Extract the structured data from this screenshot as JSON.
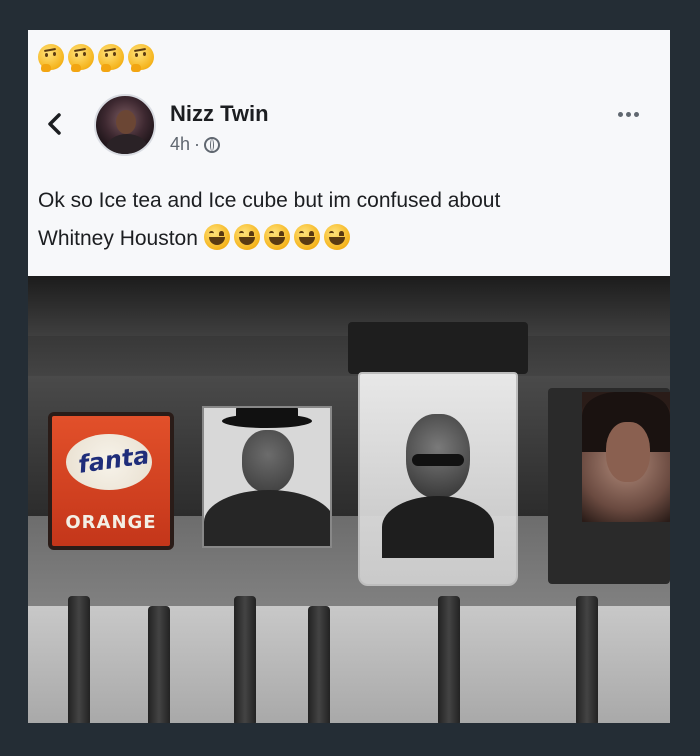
{
  "header": {
    "top_emoji_icon": "thinking-face-icon",
    "top_emoji_count": 4
  },
  "post": {
    "author_name": "Nizz Twin",
    "time": "4h",
    "meta_separator": "·",
    "audience_icon": "globe-icon",
    "text_line1": "Ok so Ice tea and Ice cube but im confused about",
    "text_line2": "Whitney Houston",
    "trailing_emoji_icon": "tears-of-joy-icon",
    "trailing_emoji_count": 5,
    "more_icon": "more-options-icon",
    "back_icon": "back-arrow-icon"
  },
  "photo": {
    "fanta_brand": "fanta",
    "fanta_flavor": "ORANGE"
  }
}
